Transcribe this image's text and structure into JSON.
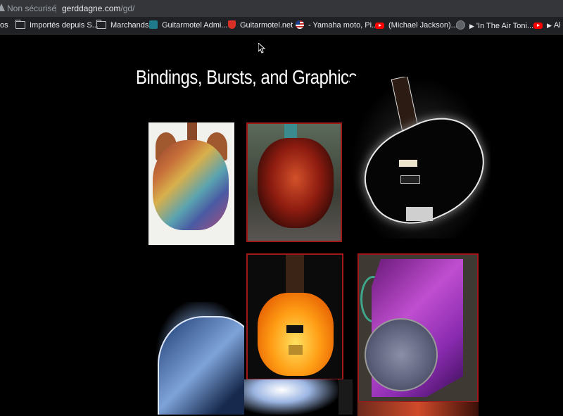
{
  "address_bar": {
    "security_label": "Non sécurisé",
    "url_host": "gerddagne.com",
    "url_path": "/gd/"
  },
  "bookmarks": [
    {
      "label": "os",
      "icon": "none"
    },
    {
      "label": "Importés depuis S...",
      "icon": "folder-icon"
    },
    {
      "label": "Marchands",
      "icon": "folder-icon"
    },
    {
      "label": "Guitarmotel Admi...",
      "icon": "guitarmotel-icon"
    },
    {
      "label": "Guitarmotel.net",
      "icon": "shield-icon"
    },
    {
      "label": "- Yamaha moto, Pi...",
      "icon": "flag-icon"
    },
    {
      "label": "(Michael Jackson)...",
      "icon": "youtube-icon"
    },
    {
      "label": "'In The Air Toni...",
      "icon": "globe-icon"
    },
    {
      "label": "Al D",
      "icon": "youtube-icon"
    }
  ],
  "page": {
    "title": "Bindings, Bursts, and Graphics",
    "photos": [
      {
        "alt": "multicolor graphic guitar body"
      },
      {
        "alt": "red burst guitar body"
      },
      {
        "alt": "black guitar with white binding"
      },
      {
        "alt": "orange burst guitar"
      },
      {
        "alt": "purple burst guitar with emblem"
      },
      {
        "alt": "blue graphic guitar"
      }
    ]
  },
  "colors": {
    "page_background": "#000000",
    "photo_border": "#a01818",
    "toolbar": "#35363a",
    "bookmarks_bar": "#202124"
  }
}
